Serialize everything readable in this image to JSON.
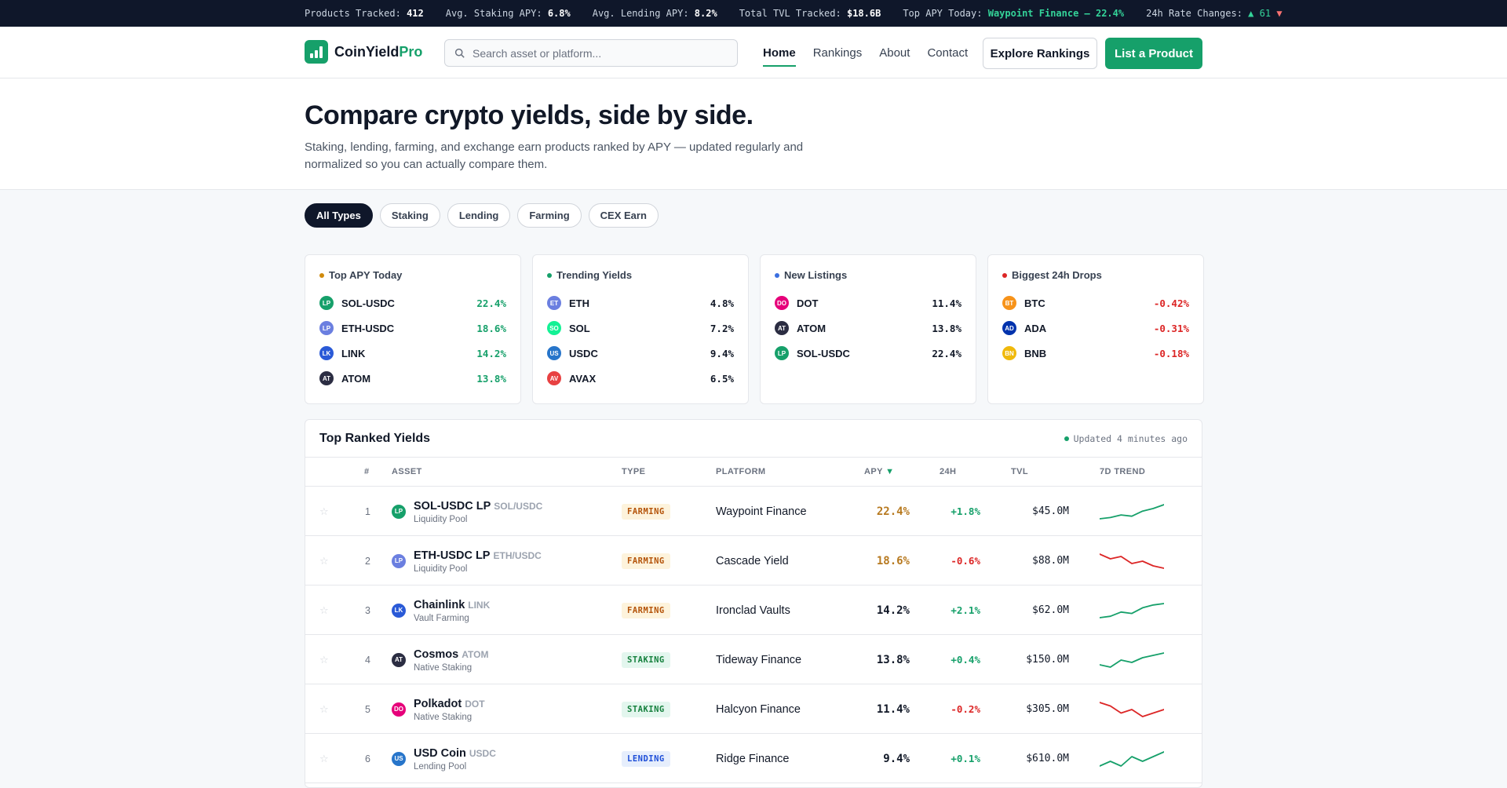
{
  "ticker": [
    {
      "label": "Products Tracked:",
      "value": "412"
    },
    {
      "label": "Avg. Staking APY:",
      "value": "6.8%"
    },
    {
      "label": "Avg. Lending APY:",
      "value": "8.2%"
    },
    {
      "label": "Total TVL Tracked:",
      "value": "$18.6B"
    },
    {
      "label": "Top APY Today:",
      "value": "Waypoint Finance — 22.4%"
    }
  ],
  "rate_changes": {
    "label": "24h Rate Changes:",
    "up": "▲ 61",
    "down": "▼"
  },
  "logo": {
    "name": "CoinYield",
    "suffix": "Pro"
  },
  "search": {
    "placeholder": "Search asset or platform..."
  },
  "nav": {
    "items": [
      "Home",
      "Rankings",
      "About",
      "Contact"
    ],
    "explore_label": "Explore Rankings",
    "list_label": "List a Product"
  },
  "hero": {
    "title": "Compare crypto yields, side by side.",
    "subtitle": "Staking, lending, farming, and exchange earn products ranked by APY — updated regularly and normalized so you can actually compare them."
  },
  "filters": [
    "All Types",
    "Staking",
    "Lending",
    "Farming",
    "CEX Earn"
  ],
  "cards": [
    {
      "title": "Top APY Today",
      "dot": "#d08a0c",
      "value_color": "#16a06a",
      "rows": [
        {
          "icon": "LP",
          "color": "#16a06a",
          "name": "SOL-USDC",
          "value": "22.4%"
        },
        {
          "icon": "LP",
          "color": "#6b7fe0",
          "name": "ETH-USDC",
          "value": "18.6%"
        },
        {
          "icon": "LK",
          "color": "#2a5ad7",
          "name": "LINK",
          "value": "14.2%"
        },
        {
          "icon": "AT",
          "color": "#2b2d42",
          "name": "ATOM",
          "value": "13.8%"
        }
      ]
    },
    {
      "title": "Trending Yields",
      "dot": "#16a06a",
      "value_color": "#111827",
      "rows": [
        {
          "icon": "ET",
          "color": "#6b7fe0",
          "name": "ETH",
          "value": "4.8%"
        },
        {
          "icon": "SO",
          "color": "#14f195",
          "name": "SOL",
          "value": "7.2%"
        },
        {
          "icon": "US",
          "color": "#2775ca",
          "name": "USDC",
          "value": "9.4%"
        },
        {
          "icon": "AV",
          "color": "#e84142",
          "name": "AVAX",
          "value": "6.5%"
        }
      ]
    },
    {
      "title": "New Listings",
      "dot": "#3b6fe0",
      "value_color": "#111827",
      "rows": [
        {
          "icon": "DO",
          "color": "#e6007a",
          "name": "DOT",
          "value": "11.4%"
        },
        {
          "icon": "AT",
          "color": "#2b2d42",
          "name": "ATOM",
          "value": "13.8%"
        },
        {
          "icon": "LP",
          "color": "#16a06a",
          "name": "SOL-USDC",
          "value": "22.4%"
        }
      ]
    },
    {
      "title": "Biggest 24h Drops",
      "dot": "#dc2626",
      "value_color": "#dc2626",
      "rows": [
        {
          "icon": "BT",
          "color": "#f7931a",
          "name": "BTC",
          "value": "-0.42%"
        },
        {
          "icon": "AD",
          "color": "#0033ad",
          "name": "ADA",
          "value": "-0.31%"
        },
        {
          "icon": "BN",
          "color": "#f0b90b",
          "name": "BNB",
          "value": "-0.18%"
        }
      ]
    }
  ],
  "table": {
    "title": "Top Ranked Yields",
    "updated": "Updated 4 minutes ago",
    "columns": [
      "#",
      "ASSET",
      "TYPE",
      "PLATFORM",
      "APY",
      "24H",
      "TVL",
      "7D TREND"
    ],
    "sort_indicator": "▼",
    "rows": [
      {
        "rank": "1",
        "icon": "LP",
        "color": "#16a06a",
        "name": "SOL-USDC LP",
        "sym": "SOL/USDC",
        "sub": "Liquidity Pool",
        "type": "FARMING",
        "platform": "Waypoint Finance",
        "apy": "22.4%",
        "apy_color": "#b7791f",
        "change": "+1.8%",
        "tvl": "$45.0M",
        "trend": [
          3,
          4,
          6,
          5,
          9,
          11,
          14
        ]
      },
      {
        "rank": "2",
        "icon": "LP",
        "color": "#6b7fe0",
        "name": "ETH-USDC LP",
        "sym": "ETH/USDC",
        "sub": "Liquidity Pool",
        "type": "FARMING",
        "platform": "Cascade Yield",
        "apy": "18.6%",
        "apy_color": "#b7791f",
        "change": "-0.6%",
        "tvl": "$88.0M",
        "trend": [
          12,
          10,
          11,
          8,
          9,
          7,
          6
        ]
      },
      {
        "rank": "3",
        "icon": "LK",
        "color": "#2a5ad7",
        "name": "Chainlink",
        "sym": "LINK",
        "sub": "Vault Farming",
        "type": "FARMING",
        "platform": "Ironclad Vaults",
        "apy": "14.2%",
        "apy_color": "#111827",
        "change": "+2.1%",
        "tvl": "$62.0M",
        "trend": [
          3,
          4,
          7,
          6,
          10,
          12,
          13
        ]
      },
      {
        "rank": "4",
        "icon": "AT",
        "color": "#2b2d42",
        "name": "Cosmos",
        "sym": "ATOM",
        "sub": "Native Staking",
        "type": "STAKING",
        "platform": "Tideway Finance",
        "apy": "13.8%",
        "apy_color": "#111827",
        "change": "+0.4%",
        "tvl": "$150.0M",
        "trend": [
          6,
          5,
          8,
          7,
          9,
          10,
          11
        ]
      },
      {
        "rank": "5",
        "icon": "DO",
        "color": "#e6007a",
        "name": "Polkadot",
        "sym": "DOT",
        "sub": "Native Staking",
        "type": "STAKING",
        "platform": "Halcyon Finance",
        "apy": "11.4%",
        "apy_color": "#111827",
        "change": "-0.2%",
        "tvl": "$305.0M",
        "trend": [
          11,
          10,
          8,
          9,
          7,
          8,
          9
        ]
      },
      {
        "rank": "6",
        "icon": "US",
        "color": "#2775ca",
        "name": "USD Coin",
        "sym": "USDC",
        "sub": "Lending Pool",
        "type": "LENDING",
        "platform": "Ridge Finance",
        "apy": "9.4%",
        "apy_color": "#111827",
        "change": "+0.1%",
        "tvl": "$610.0M",
        "trend": [
          6,
          7,
          6,
          8,
          7,
          8,
          9
        ]
      }
    ]
  },
  "colors": {
    "accent": "#16a06a",
    "up": "#16a06a",
    "down": "#dc2626"
  }
}
